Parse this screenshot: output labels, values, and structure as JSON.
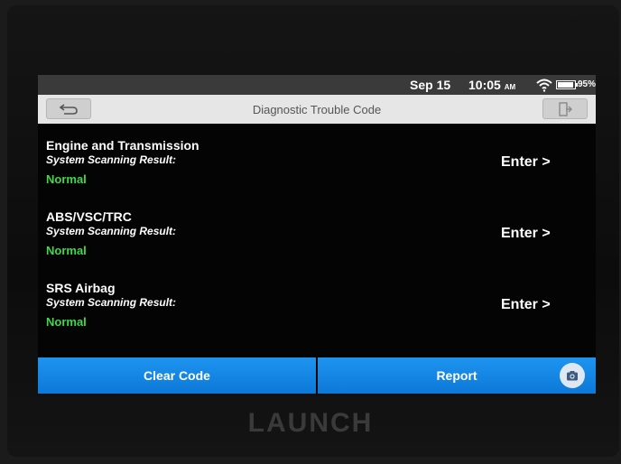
{
  "status_bar": {
    "date": "Sep 15",
    "time": "10:05",
    "ampm": "AM",
    "battery_pct": "95%",
    "battery_level": 0.95,
    "icons": [
      "wifi-icon",
      "battery-icon"
    ]
  },
  "header": {
    "title": "Diagnostic Trouble Code",
    "back_icon": "back-arrow-icon",
    "exit_icon": "exit-icon"
  },
  "systems": [
    {
      "name": "Engine and Transmission",
      "label": "System Scanning Result:",
      "status": "Normal",
      "action": "Enter >"
    },
    {
      "name": "ABS/VSC/TRC",
      "label": "System Scanning Result:",
      "status": "Normal",
      "action": "Enter >"
    },
    {
      "name": "SRS Airbag",
      "label": "System Scanning Result:",
      "status": "Normal",
      "action": "Enter >"
    }
  ],
  "footer": {
    "clear_label": "Clear Code",
    "report_label": "Report",
    "camera_icon": "camera-icon"
  },
  "device": {
    "brand": "LAUNCH"
  },
  "colors": {
    "accent_blue": "#1488e6",
    "status_green": "#3fd94a",
    "screen_bg": "#040404",
    "title_bg": "#e6e6e6"
  }
}
